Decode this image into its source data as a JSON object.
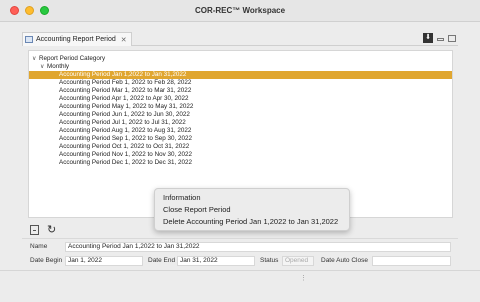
{
  "window": {
    "title": "COR-REC™ Workspace"
  },
  "tab": {
    "label": "Accounting Report Period",
    "close": "✕"
  },
  "view_tools": {
    "download": "⬇"
  },
  "tree": {
    "root_label": "Report Period Category",
    "group_label": "Monthly",
    "selected_label": "Accounting Period Jan 1,2022 to Jan 31,2022",
    "items": [
      "Accounting Period Feb 1, 2022 to Feb 28, 2022",
      "Accounting Period Mar 1, 2022 to Mar 31, 2022",
      "Accounting Period Apr 1, 2022 to Apr 30, 2022",
      "Accounting Period May 1, 2022 to May 31, 2022",
      "Accounting Period Jun 1, 2022 to Jun 30, 2022",
      "Accounting Period Jul 1, 2022 to Jul 31, 2022",
      "Accounting Period Aug 1, 2022 to Aug 31, 2022",
      "Accounting Period Sep 1, 2022 to Sep 30, 2022",
      "Accounting Period Oct 1, 2022 to Oct 31, 2022",
      "Accounting Period Nov 1, 2022 to Nov 30, 2022",
      "Accounting Period Dec 1, 2022 to Dec 31, 2022"
    ],
    "selected_color": "#e0a62f"
  },
  "context_menu": {
    "items": [
      "Information",
      "Close Report Period",
      "Delete Accounting Period Jan 1,2022 to Jan 31,2022"
    ]
  },
  "form": {
    "name_label": "Name",
    "name_value": "Accounting Period Jan 1,2022 to Jan 31,2022",
    "date_begin_label": "Date Begin",
    "date_begin_value": "Jan 1, 2022",
    "date_end_label": "Date End",
    "date_end_value": "Jan 31, 2022",
    "status_label": "Status",
    "status_value": "Opened",
    "date_auto_close_label": "Date Auto Close",
    "date_auto_close_value": ""
  },
  "icons": {
    "collapse": "collapse-all-icon",
    "refresh": "refresh-icon",
    "refresh_glyph": "↻",
    "grip_glyph": "⋮"
  }
}
